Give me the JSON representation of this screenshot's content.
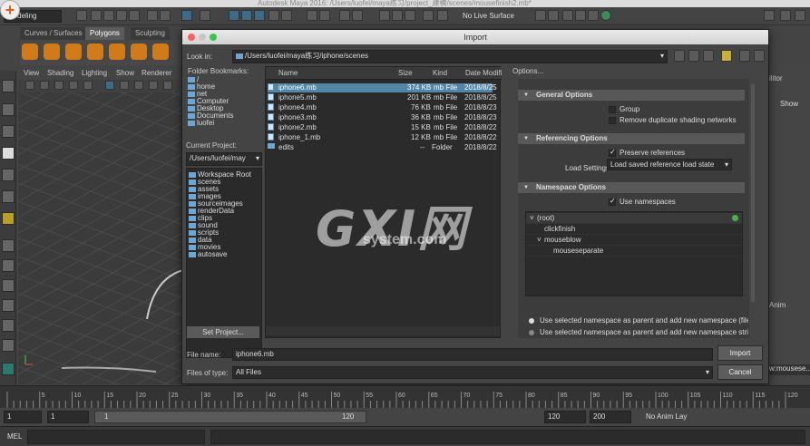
{
  "window": {
    "title": "Autodesk Maya 2016: /Users/luofei/maya练习/project_建模/scenes/mousefinish2.mb*"
  },
  "toolbar": {
    "mode_menu": "Modeling",
    "live_surface": "No Live Surface"
  },
  "shelf": {
    "tabs": [
      "Curves / Surfaces",
      "Polygons",
      "Sculpting"
    ],
    "active_tab": "Polygons"
  },
  "viewport": {
    "menu": [
      "View",
      "Shading",
      "Lighting",
      "Show",
      "Renderer"
    ]
  },
  "right_panel": {
    "label": "ilitor",
    "show": "Show",
    "anim": "Anim",
    "node": "w:mousese..."
  },
  "dialog": {
    "title": "Import",
    "look_in_label": "Look in:",
    "look_in_path": "/Users/luofei/maya练习/iphone/scenes",
    "folder_bookmarks_label": "Folder Bookmarks:",
    "bookmarks": [
      "/",
      "home",
      "net",
      "Computer",
      "Desktop",
      "Documents",
      "luofei"
    ],
    "current_project_label": "Current Project:",
    "current_project": "/Users/luofei/may",
    "project_dirs": [
      "Workspace Root",
      "scenes",
      "assets",
      "images",
      "sourceimages",
      "renderData",
      "clips",
      "sound",
      "scripts",
      "data",
      "movies",
      "autosave"
    ],
    "set_project_button": "Set Project...",
    "columns": [
      "Name",
      "Size",
      "Kind",
      "Date Modifi"
    ],
    "files": [
      {
        "name": "iphone6.mb",
        "size": "374 KB",
        "kind": "mb File",
        "date": "2018/8/25",
        "selected": true
      },
      {
        "name": "iphone5.mb",
        "size": "201 KB",
        "kind": "mb File",
        "date": "2018/8/25"
      },
      {
        "name": "iphone4.mb",
        "size": "76 KB",
        "kind": "mb File",
        "date": "2018/8/23"
      },
      {
        "name": "iphone3.mb",
        "size": "36 KB",
        "kind": "mb File",
        "date": "2018/8/23"
      },
      {
        "name": "iphone2.mb",
        "size": "15 KB",
        "kind": "mb File",
        "date": "2018/8/22"
      },
      {
        "name": "iphone_1.mb",
        "size": "12 KB",
        "kind": "mb File",
        "date": "2018/8/22"
      },
      {
        "name": "edits",
        "size": "--",
        "kind": "Folder",
        "date": "2018/8/22"
      }
    ],
    "options_label": "Options...",
    "general_options": {
      "title": "General Options",
      "group": "Group",
      "remove_dup": "Remove duplicate shading networks"
    },
    "referencing_options": {
      "title": "Referencing Options",
      "preserve": "Preserve references",
      "load_settings_label": "Load Settings",
      "load_settings_value": "Load saved reference load state"
    },
    "namespace_options": {
      "title": "Namespace Options",
      "use_namespaces": "Use namespaces",
      "tree": [
        "(root)",
        "clickfinish",
        "mouseblow",
        "mouseseparate"
      ]
    },
    "radio_options": [
      "Use selected namespace as parent and add new namespace (file na",
      "Use selected namespace as parent and add new namespace string:"
    ],
    "file_name_label": "File name:",
    "file_name": "iphone6.mb",
    "files_of_type_label": "Files of type:",
    "files_of_type": "All Files",
    "import_button": "Import",
    "cancel_button": "Cancel"
  },
  "timeline": {
    "ticks": [
      "5",
      "10",
      "15",
      "20",
      "25",
      "30",
      "35",
      "40",
      "45",
      "50",
      "55",
      "60",
      "65",
      "70",
      "75",
      "80",
      "85",
      "90",
      "95",
      "100",
      "105",
      "110",
      "115",
      "120"
    ]
  },
  "range": {
    "start": "1",
    "start2": "1",
    "slider_start": "1",
    "slider_end": "120",
    "end": "120",
    "end2": "200",
    "anim_layer": "No Anim Lay"
  },
  "command_line": {
    "label": "MEL"
  },
  "watermark": {
    "big": "GXI网",
    "small": "system.com"
  }
}
